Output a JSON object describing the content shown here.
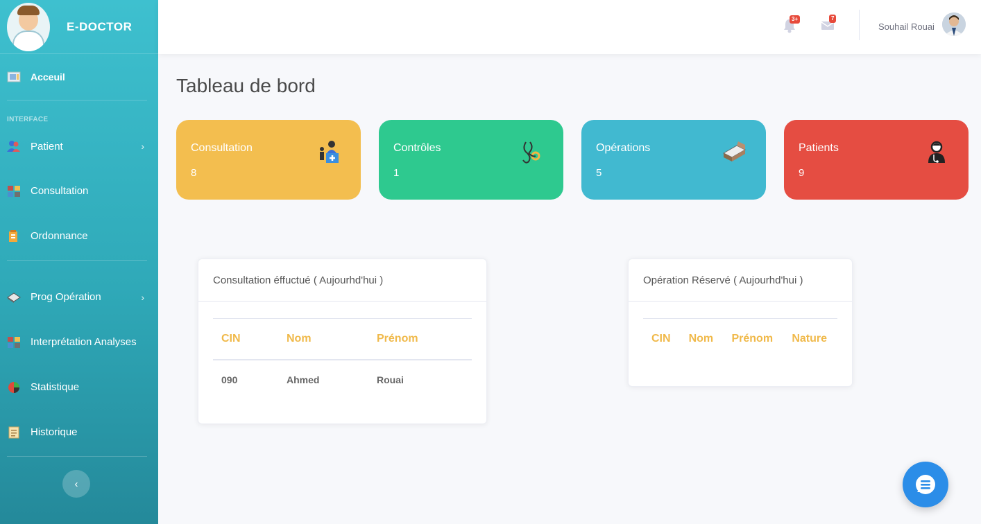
{
  "brand": {
    "name": "E-DOCTOR"
  },
  "sidebar": {
    "items_top": [
      {
        "label": "Acceuil",
        "icon": "dashboard-icon"
      }
    ],
    "section_label": "INTERFACE",
    "items_main": [
      {
        "label": "Patient",
        "icon": "users-icon",
        "chevron": true
      },
      {
        "label": "Consultation",
        "icon": "archive-icon",
        "chevron": false
      },
      {
        "label": "Ordonnance",
        "icon": "prescription-icon",
        "chevron": false
      }
    ],
    "items_lower": [
      {
        "label": "Prog Opération",
        "icon": "diamond-icon",
        "chevron": true
      },
      {
        "label": "Interprétation Analyses",
        "icon": "archive-icon",
        "chevron": false
      },
      {
        "label": "Statistique",
        "icon": "chart-icon",
        "chevron": false
      },
      {
        "label": "Historique",
        "icon": "document-icon",
        "chevron": false
      }
    ],
    "toggle_glyph": "‹"
  },
  "topbar": {
    "alerts_badge": "3+",
    "messages_badge": "7",
    "user_name": "Souhail Rouai"
  },
  "page": {
    "title": "Tableau de bord"
  },
  "stats": [
    {
      "label": "Consultation",
      "value": "8",
      "color": "#f3be4f",
      "icon": "doctor-desk-icon"
    },
    {
      "label": "Contrôles",
      "value": "1",
      "color": "#2ec98f",
      "icon": "stethoscope-icon"
    },
    {
      "label": "Opérations",
      "value": "5",
      "color": "#41b9d0",
      "icon": "bed-icon"
    },
    {
      "label": "Patients",
      "value": "9",
      "color": "#e54d42",
      "icon": "patient-icon"
    }
  ],
  "consultations": {
    "title": "Consultation éffuctué ( Aujourhd'hui )",
    "headers": [
      "CIN",
      "Nom",
      "Prénom"
    ],
    "rows": [
      [
        "090",
        "Ahmed",
        "Rouai"
      ]
    ]
  },
  "operations": {
    "title": "Opération Réservé ( Aujourhd'hui )",
    "headers": [
      "CIN",
      "Nom",
      "Prénom",
      "Nature"
    ],
    "rows": []
  }
}
